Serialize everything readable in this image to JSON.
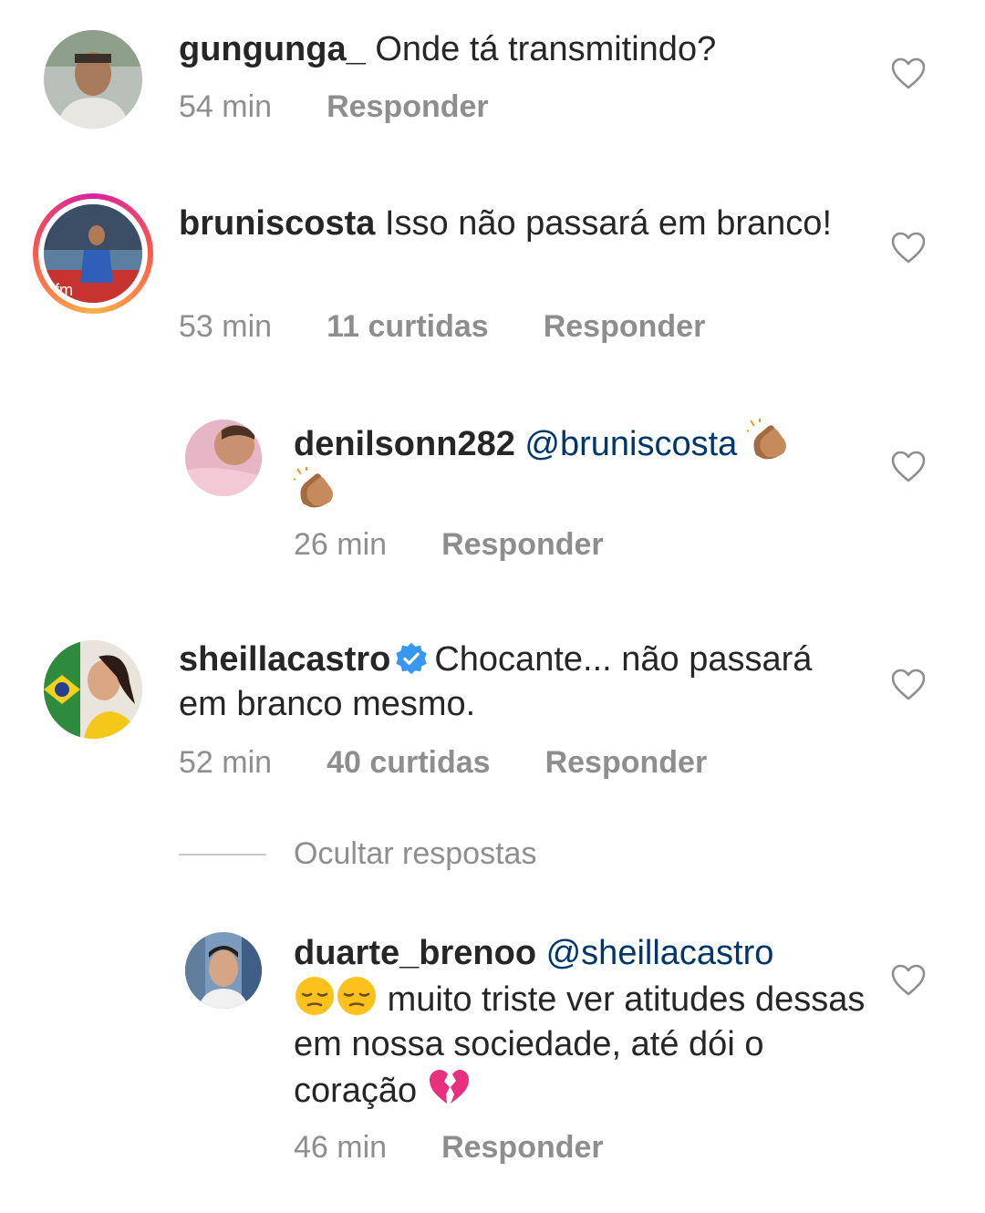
{
  "comments": [
    {
      "username": "gungunga_",
      "text": "Onde tá transmitindo?",
      "time": "54 min",
      "reply": "Responder"
    },
    {
      "username": "bruniscosta",
      "text": "Isso não passará em branco!",
      "time": "53 min",
      "likes": "11 curtidas",
      "reply": "Responder",
      "story_ring": true
    },
    {
      "username": "sheillacastro",
      "verified": true,
      "text": "Chocante... não passará em branco mesmo.",
      "time": "52 min",
      "likes": "40 curtidas",
      "reply": "Responder"
    }
  ],
  "replies": [
    {
      "username": "denilsonn282",
      "mention": "@bruniscosta",
      "emojis": [
        "clapping-hands",
        "clapping-hands"
      ],
      "time": "26 min",
      "reply": "Responder"
    },
    {
      "username": "duarte_brenoo",
      "mention": "@sheillacastro",
      "emojis": [
        "pensive-face",
        "pensive-face"
      ],
      "text": "muito triste ver atitudes dessas em nossa sociedade, até dói o coração",
      "trailing_emoji": "broken-heart",
      "time": "46 min",
      "reply": "Responder"
    }
  ],
  "hide_replies_label": "Ocultar respostas",
  "colors": {
    "text": "#262626",
    "secondary": "#8e8e8e",
    "mention": "#00376b",
    "verified": "#3897f0"
  }
}
